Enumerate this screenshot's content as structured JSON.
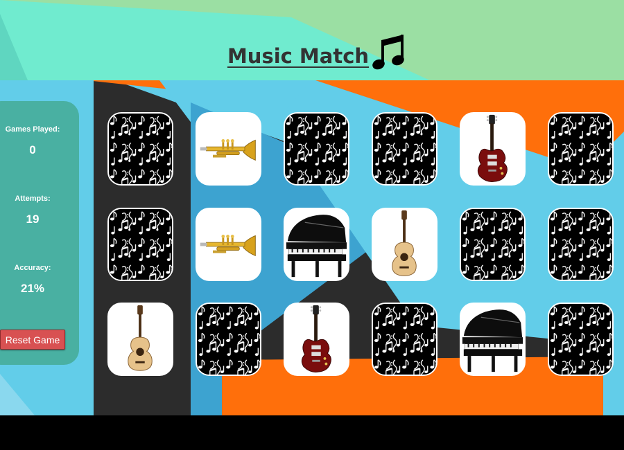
{
  "header": {
    "title": "Music Match"
  },
  "stats": {
    "games_played_label": "Games Played:",
    "games_played": "0",
    "attempts_label": "Attempts:",
    "attempts": "19",
    "accuracy_label": "Accuracy:",
    "accuracy": "21%"
  },
  "reset_label": "Reset Game",
  "colors": {
    "header_green": "#9bdfa3",
    "teal": "#70ebcf",
    "sky_blue": "#62cde9",
    "orange": "#ff6f0b",
    "dark": "#2c2c2c",
    "reset_red": "#d85152"
  },
  "board": {
    "rows": [
      [
        "back",
        "trumpet",
        "back",
        "back",
        "electric-guitar",
        "back"
      ],
      [
        "back",
        "trumpet",
        "piano",
        "acoustic-guitar",
        "back",
        "back"
      ],
      [
        "acoustic-guitar",
        "back",
        "electric-guitar",
        "back",
        "piano",
        "back"
      ]
    ]
  }
}
